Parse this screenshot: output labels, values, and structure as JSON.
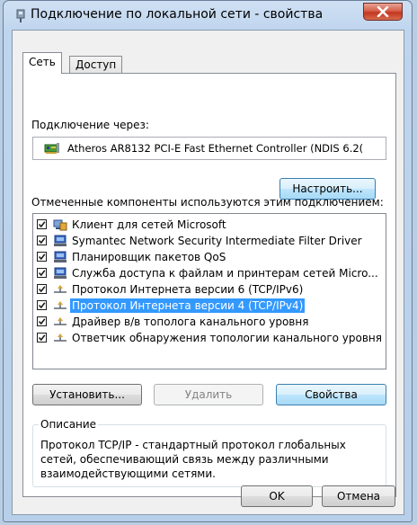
{
  "window": {
    "title": "Подключение по локальной сети - свойства",
    "close_symbol": "x"
  },
  "tabs": [
    {
      "label": "Сеть",
      "active": true
    },
    {
      "label": "Доступ",
      "active": false
    }
  ],
  "connection": {
    "label": "Подключение через:",
    "adapter": "Atheros AR8132 PCI-E Fast Ethernet Controller (NDIS 6.2(",
    "configure_button": "Настроить..."
  },
  "components": {
    "label": "Отмеченные компоненты используются этим подключением:",
    "items": [
      {
        "label": "Клиент для сетей Microsoft",
        "checked": true,
        "icon": "network-client-icon",
        "selected": false
      },
      {
        "label": "Symantec Network Security Intermediate Filter Driver",
        "checked": true,
        "icon": "network-service-icon",
        "selected": false
      },
      {
        "label": "Планировщик пакетов QoS",
        "checked": true,
        "icon": "network-service-icon",
        "selected": false
      },
      {
        "label": "Служба доступа к файлам и принтерам сетей Micro...",
        "checked": true,
        "icon": "network-service-icon",
        "selected": false
      },
      {
        "label": "Протокол Интернета версии 6 (TCP/IPv6)",
        "checked": true,
        "icon": "network-protocol-icon",
        "selected": false
      },
      {
        "label": "Протокол Интернета версии 4 (TCP/IPv4)",
        "checked": true,
        "icon": "network-protocol-icon",
        "selected": true
      },
      {
        "label": "Драйвер в/в тополога канального уровня",
        "checked": true,
        "icon": "network-protocol-icon",
        "selected": false
      },
      {
        "label": "Ответчик обнаружения топологии канального уровня",
        "checked": true,
        "icon": "network-protocol-icon",
        "selected": false
      }
    ]
  },
  "actions": {
    "install": "Установить...",
    "remove": "Удалить",
    "properties": "Свойства"
  },
  "description": {
    "legend": "Описание",
    "text": "Протокол TCP/IP - стандартный протокол глобальных сетей, обеспечивающий связь между различными взаимодействующими сетями."
  },
  "footer": {
    "ok": "OK",
    "cancel": "Отмена"
  },
  "colors": {
    "selection": "#3399ff",
    "close_button": "#c4361f",
    "window_frame": "#bfd5ee"
  }
}
